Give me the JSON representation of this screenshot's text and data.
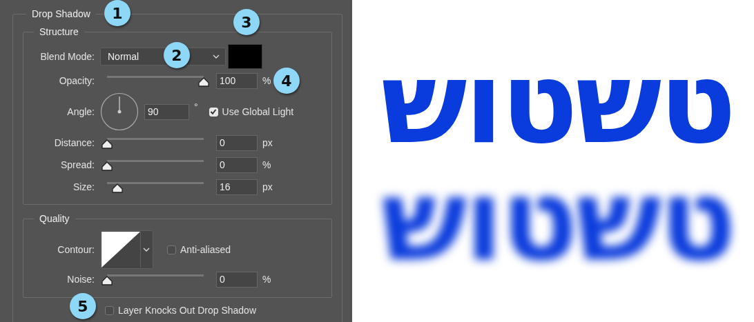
{
  "panel": {
    "title": "Drop Shadow",
    "structure": {
      "title": "Structure",
      "rows": [
        {
          "kind": "select",
          "label": "Blend Mode:",
          "value": "Normal"
        },
        {
          "kind": "slider",
          "label": "Opacity:",
          "level": 1,
          "value": "100",
          "unit": "%"
        },
        {
          "kind": "angle",
          "label": "Angle:",
          "value": "90",
          "unit": "°",
          "checkbox": {
            "label": "Use Global Light",
            "checked": true
          }
        },
        {
          "kind": "slider",
          "label": "Distance:",
          "level": 0,
          "value": "0",
          "unit": "px"
        },
        {
          "kind": "slider",
          "label": "Spread:",
          "level": 0,
          "value": "0",
          "unit": "%"
        },
        {
          "kind": "slider",
          "label": "Size:",
          "level": 0.11,
          "value": "16",
          "unit": "px"
        }
      ]
    },
    "quality": {
      "title": "Quality",
      "contour": {
        "label": "Contour:",
        "checkbox": {
          "label": "Anti-aliased",
          "checked": false
        }
      },
      "noise": {
        "label": "Noise:",
        "level": 0,
        "value": "0",
        "unit": "%"
      }
    },
    "knockout": {
      "label": "Layer Knocks Out Drop Shadow",
      "checked": false
    }
  },
  "callouts": [
    {
      "number": "1"
    },
    {
      "number": "2"
    },
    {
      "number": "3"
    },
    {
      "number": "4"
    },
    {
      "number": "5"
    }
  ],
  "preview": [
    {
      "text": "טשטוש",
      "blurred": false
    },
    {
      "text": "טשטוש",
      "blurred": true
    }
  ]
}
